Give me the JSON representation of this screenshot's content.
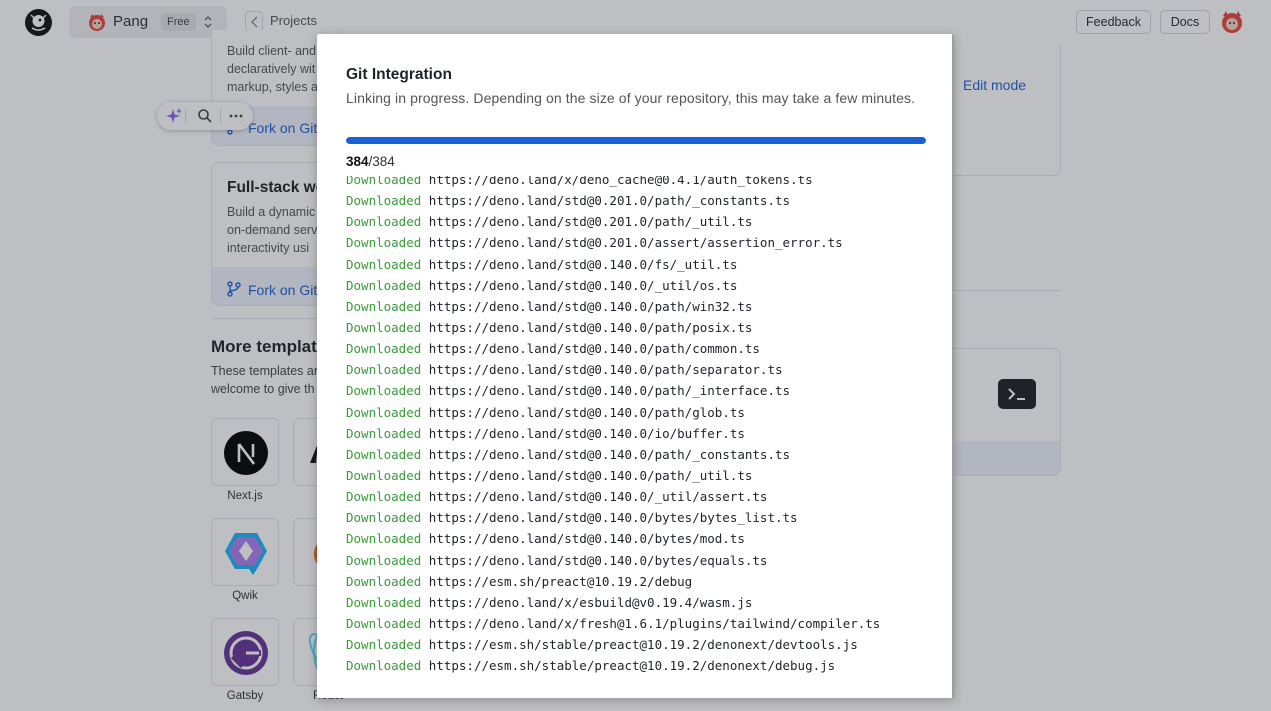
{
  "header": {
    "project_name": "Pang",
    "plan_badge": "Free",
    "breadcrumb": "Projects",
    "feedback_label": "Feedback",
    "docs_label": "Docs"
  },
  "background": {
    "card1": {
      "text_lines": [
        "Build client- and",
        "declaratively wit",
        "markup, styles a"
      ],
      "fork_label": "Fork on Git"
    },
    "card2": {
      "title": "Full-stack we",
      "text_lines": [
        "Build a dynamic",
        "on-demand serv",
        "interactivity usi"
      ],
      "fork_label": "Fork on Git"
    },
    "edit_mode_label": "Edit mode",
    "more_templates": {
      "title": "More templat",
      "desc_lines": [
        "These templates ar",
        "welcome to give th"
      ]
    },
    "templates": [
      {
        "label": "Next.js"
      },
      {
        "label": "Qwik"
      },
      {
        "label": "Gatsby"
      },
      {
        "label": "React"
      }
    ]
  },
  "modal": {
    "title": "Git Integration",
    "subtitle": "Linking in progress. Depending on the size of your repository, this may take a few minutes.",
    "progress": {
      "done": "384",
      "total": "/384",
      "fraction": 1.0
    },
    "log_status_label": "Downloaded",
    "log_lines": [
      "https://deno.land/x/deno_cache@0.4.1/auth_tokens.ts",
      "https://deno.land/std@0.201.0/path/_constants.ts",
      "https://deno.land/std@0.201.0/path/_util.ts",
      "https://deno.land/std@0.201.0/assert/assertion_error.ts",
      "https://deno.land/std@0.140.0/fs/_util.ts",
      "https://deno.land/std@0.140.0/_util/os.ts",
      "https://deno.land/std@0.140.0/path/win32.ts",
      "https://deno.land/std@0.140.0/path/posix.ts",
      "https://deno.land/std@0.140.0/path/common.ts",
      "https://deno.land/std@0.140.0/path/separator.ts",
      "https://deno.land/std@0.140.0/path/_interface.ts",
      "https://deno.land/std@0.140.0/path/glob.ts",
      "https://deno.land/std@0.140.0/io/buffer.ts",
      "https://deno.land/std@0.140.0/path/_constants.ts",
      "https://deno.land/std@0.140.0/path/_util.ts",
      "https://deno.land/std@0.140.0/_util/assert.ts",
      "https://deno.land/std@0.140.0/bytes/bytes_list.ts",
      "https://deno.land/std@0.140.0/bytes/mod.ts",
      "https://deno.land/std@0.140.0/bytes/equals.ts",
      "https://esm.sh/preact@10.19.2/debug",
      "https://deno.land/x/esbuild@v0.19.4/wasm.js",
      "https://deno.land/x/fresh@1.6.1/plugins/tailwind/compiler.ts",
      "https://esm.sh/stable/preact@10.19.2/denonext/devtools.js",
      "https://esm.sh/stable/preact@10.19.2/denonext/debug.js"
    ]
  },
  "colors": {
    "accent": "#1762d6",
    "link": "#1f5fd1",
    "log_status": "#3a9b3a"
  }
}
